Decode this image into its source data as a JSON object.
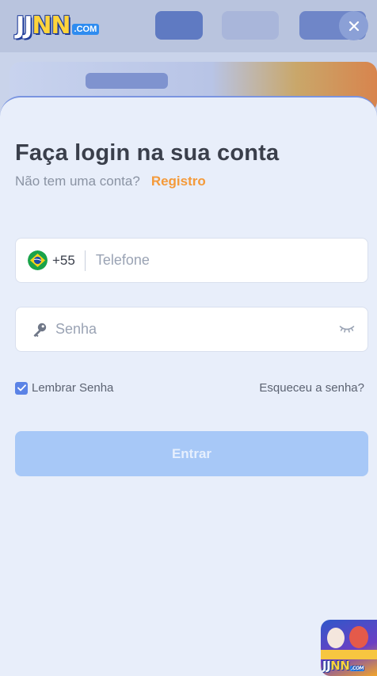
{
  "header": {
    "logo": {
      "part1": "JJ",
      "part2": "NN",
      "suffix": ".COM"
    },
    "close_icon": "close-icon"
  },
  "login": {
    "title": "Faça login na sua conta",
    "no_account_text": "Não tem uma conta?",
    "register_link": "Registro",
    "phone": {
      "flag_icon": "brazil-flag-icon",
      "country_code": "+55",
      "placeholder": "Telefone",
      "value": ""
    },
    "password": {
      "key_icon": "key-icon",
      "placeholder": "Senha",
      "value": "",
      "visibility_icon": "eye-closed-icon"
    },
    "remember_label": "Lembrar Senha",
    "remember_checked": true,
    "forgot_link": "Esqueceu a senha?",
    "submit_label": "Entrar"
  },
  "floating_app": {
    "icon": "app-promo-icon",
    "logo": {
      "part1": "JJ",
      "part2": "NN",
      "suffix": ".COM"
    }
  },
  "colors": {
    "accent_orange": "#f49a3a",
    "button_disabled": "#a7c8f7",
    "checkbox": "#5b83e6",
    "sheet_background": "#e8eefa"
  }
}
